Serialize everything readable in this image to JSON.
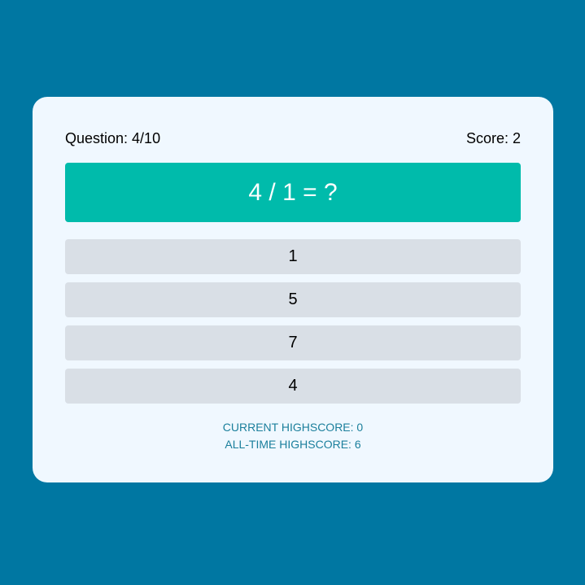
{
  "colors": {
    "background": "#0077a2",
    "card": "#f0f8ff",
    "question_box": "#00bbab",
    "answer_button": "#d9dfe6",
    "highscore_text": "#1b7f9c"
  },
  "header": {
    "question_progress": "Question: 4/10",
    "score": "Score: 2"
  },
  "question": {
    "text": "4 / 1 = ?"
  },
  "answers": [
    "1",
    "5",
    "7",
    "4"
  ],
  "highscores": {
    "current": "CURRENT HIGHSCORE: 0",
    "all_time": "ALL-TIME HIGHSCORE: 6"
  }
}
